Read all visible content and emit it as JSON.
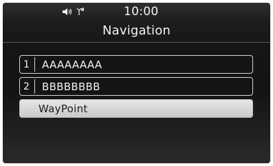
{
  "status": {
    "icons": [
      "speaker-icon",
      "antenna-icon"
    ],
    "clock": "10:00"
  },
  "screen": {
    "title": "Navigation"
  },
  "menu": {
    "items": [
      {
        "number": "1",
        "label": "AAAAAAAA",
        "selected": false
      },
      {
        "number": "2",
        "label": "BBBBBBBB",
        "selected": false
      },
      {
        "number": "",
        "label": "WayPoint",
        "selected": true
      }
    ]
  },
  "colors": {
    "background": "#151515",
    "text": "#f4f4f4",
    "item_border": "#d6d6d6",
    "selected_fill": "#d8d8d8",
    "selected_text": "#1a1a1a"
  }
}
